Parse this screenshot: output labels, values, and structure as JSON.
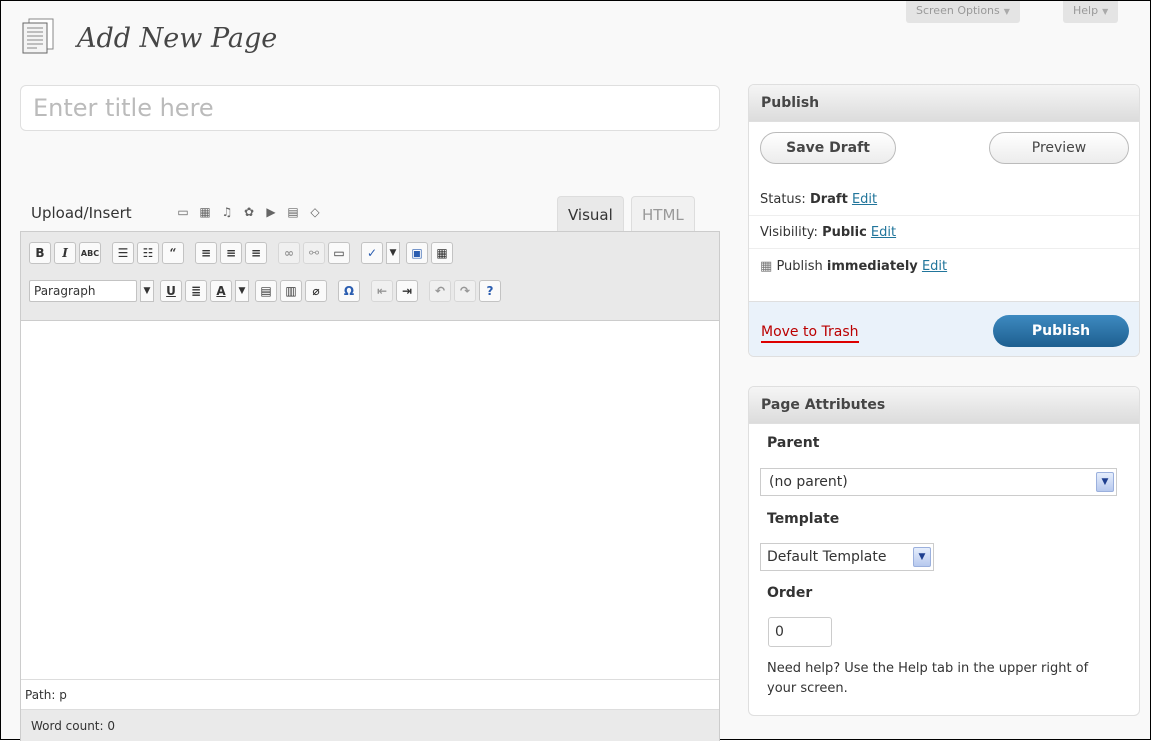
{
  "header": {
    "title": "Add New Page",
    "screen_options": "Screen Options",
    "help": "Help",
    "icon": "page-icon"
  },
  "title_input": {
    "placeholder": "Enter title here"
  },
  "media": {
    "label": "Upload/Insert",
    "icons": [
      "image-icon",
      "gallery-icon",
      "audio-icon",
      "media-icon",
      "video-icon",
      "text-icon",
      "drop-icon"
    ]
  },
  "editor": {
    "tabs": {
      "visual": "Visual",
      "html": "HTML"
    },
    "format_select": "Paragraph",
    "path_label": "Path: p",
    "word_count": "Word count: 0"
  },
  "publish": {
    "title": "Publish",
    "save_draft": "Save Draft",
    "preview": "Preview",
    "status_label": "Status:",
    "status_value": "Draft",
    "visibility_label": "Visibility:",
    "visibility_value": "Public",
    "publish_label": "Publish",
    "publish_value": "immediately",
    "edit": "Edit",
    "move_to_trash": "Move to Trash",
    "publish_button": "Publish"
  },
  "page_attributes": {
    "title": "Page Attributes",
    "parent_label": "Parent",
    "parent_value": "(no parent)",
    "template_label": "Template",
    "template_value": "Default Template",
    "order_label": "Order",
    "order_value": "0",
    "help_text": "Need help? Use the Help tab in the upper right of your screen."
  },
  "colors": {
    "link": "#21759b",
    "publish": "#21759b",
    "trash": "#bb0000"
  }
}
